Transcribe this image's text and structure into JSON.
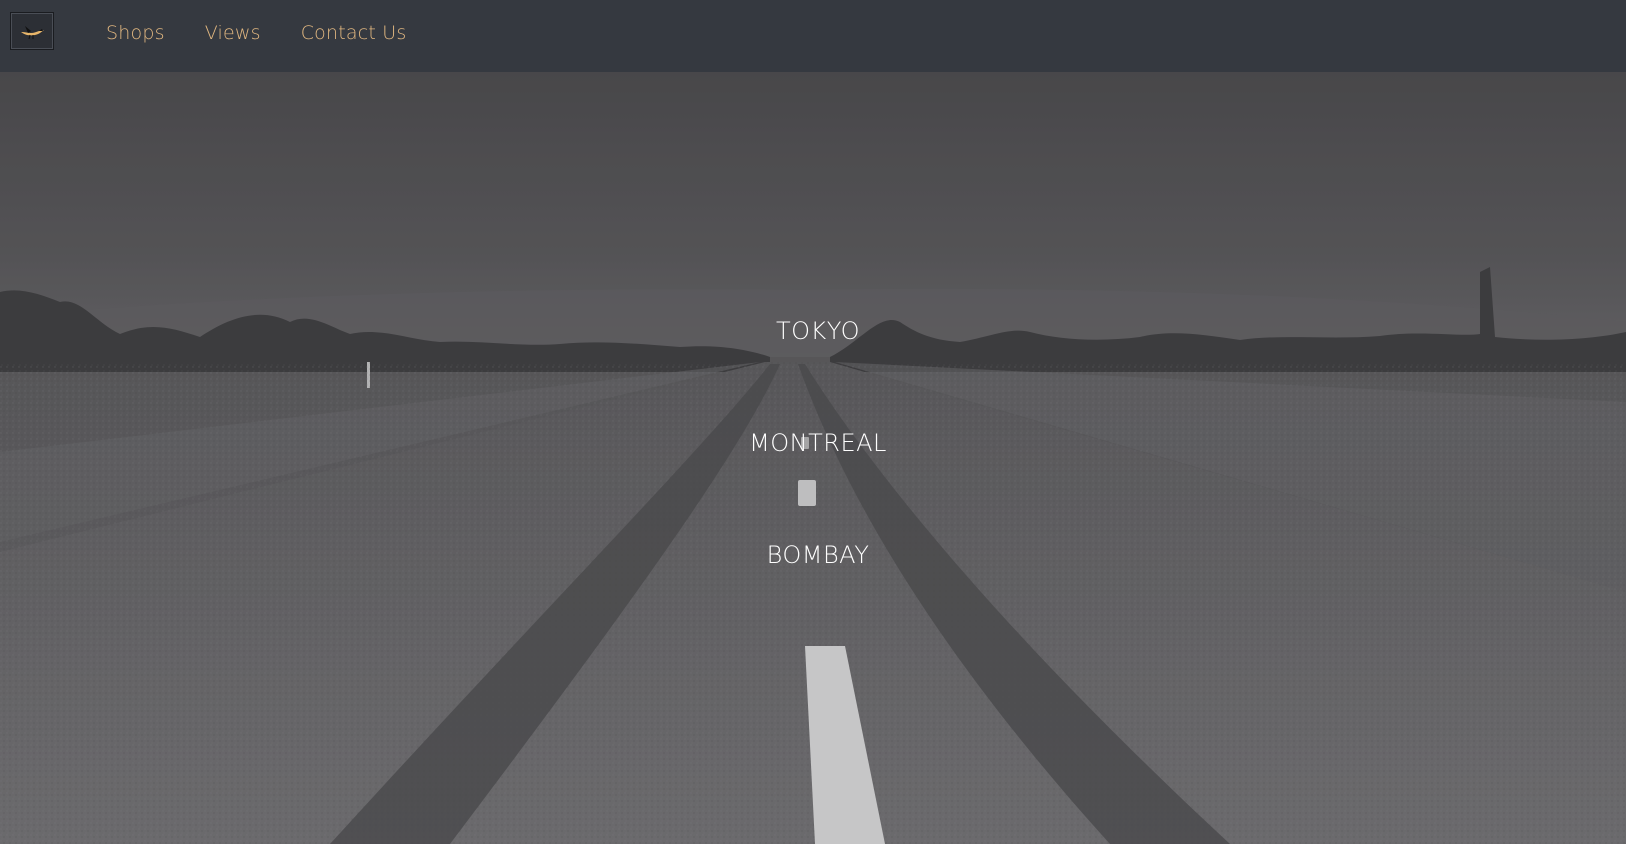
{
  "colors": {
    "navbar_bg": "#353940",
    "nav_link": "#e1b780",
    "city_text": "#ffffff",
    "hero_overlay": "#4a494b"
  },
  "header": {
    "logo_icon": "bird-logo-icon",
    "nav": [
      {
        "label": "Shops"
      },
      {
        "label": "Views"
      },
      {
        "label": "Contact Us"
      }
    ]
  },
  "hero": {
    "background": "desert-road-photo",
    "cities": [
      {
        "label": "TOKYO"
      },
      {
        "label": "MONTREAL"
      },
      {
        "label": "BOMBAY"
      }
    ]
  }
}
